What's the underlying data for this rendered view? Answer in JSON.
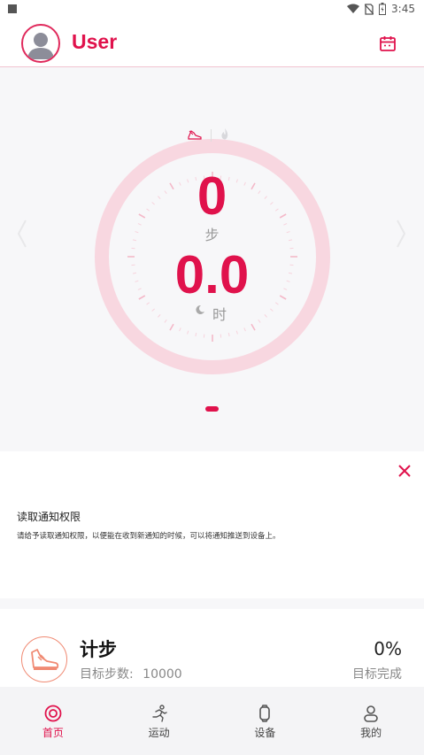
{
  "status_bar": {
    "time": "3:45"
  },
  "header": {
    "username": "User"
  },
  "dashboard": {
    "steps_value": "0",
    "steps_unit": "步",
    "hours_value": "0.0",
    "hours_unit": "时"
  },
  "notification": {
    "title": "读取通知权限",
    "body": "请给予读取通知权限，以便能在收到新通知的时候，可以将通知推送到设备上。"
  },
  "steps_card": {
    "title": "计步",
    "goal_label": "目标步数:",
    "goal_value": "10000",
    "percent": "0%",
    "percent_label": "目标完成"
  },
  "bottom_nav": {
    "items": [
      {
        "label": "首页",
        "icon": "home-icon",
        "active": true
      },
      {
        "label": "运动",
        "icon": "run-icon",
        "active": false
      },
      {
        "label": "设备",
        "icon": "watch-icon",
        "active": false
      },
      {
        "label": "我的",
        "icon": "person-icon",
        "active": false
      }
    ]
  },
  "colors": {
    "accent": "#e0124c",
    "ring": "#f8d7e0",
    "background": "#f7f7f9"
  }
}
